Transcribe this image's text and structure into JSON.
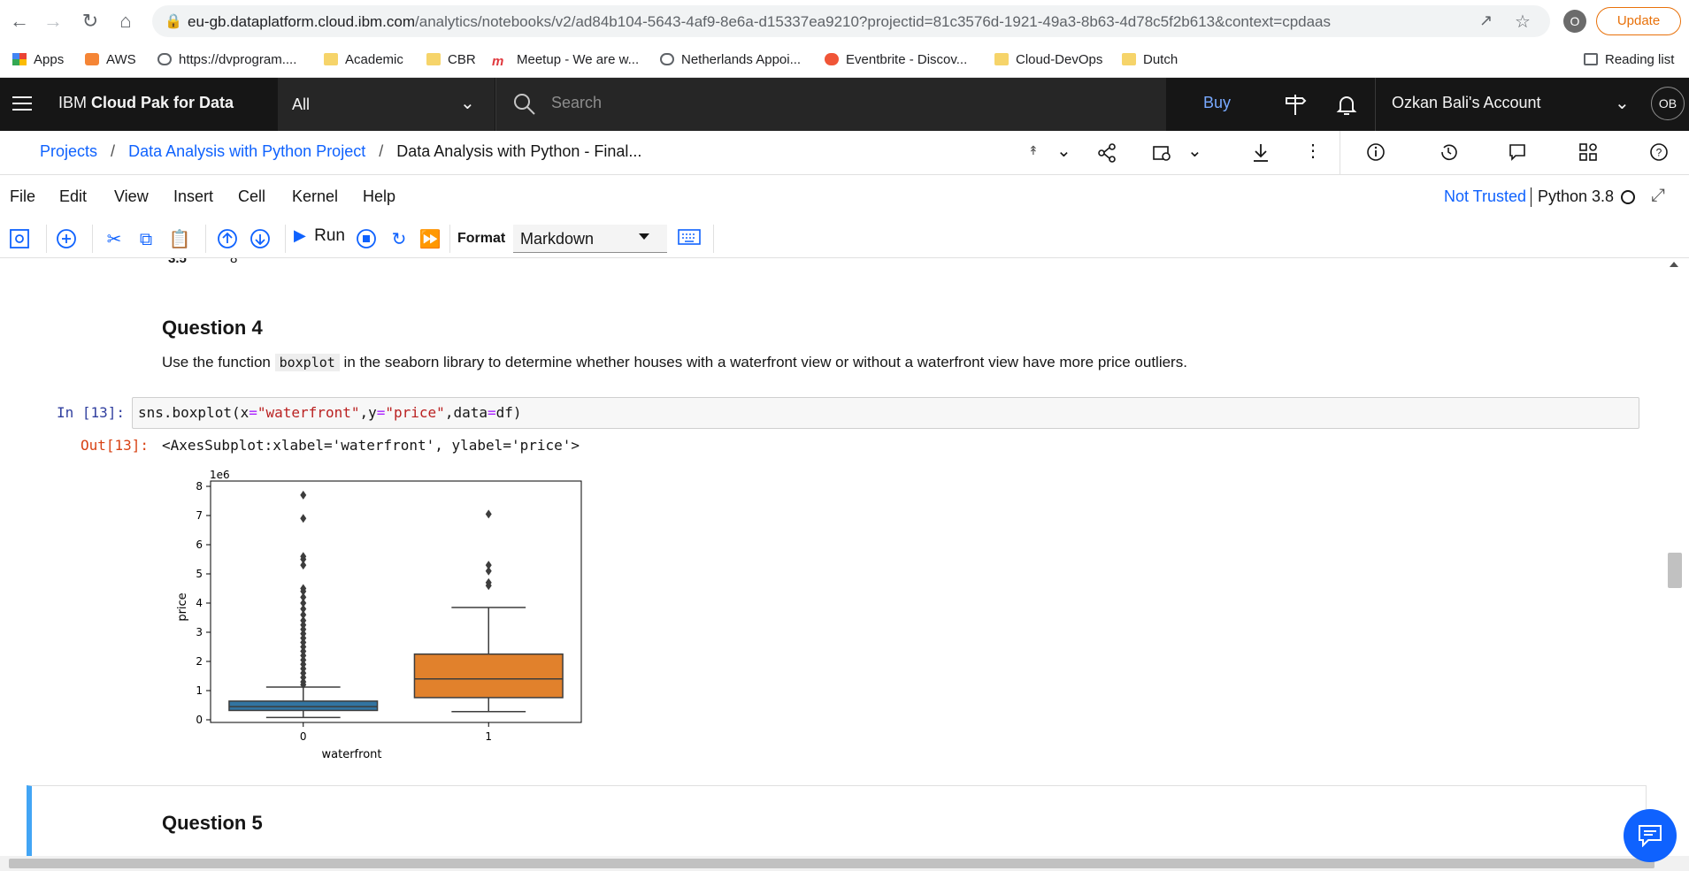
{
  "browser": {
    "url_host": "eu-gb.dataplatform.cloud.ibm.com",
    "url_path": "/analytics/notebooks/v2/ad84b104-5643-4af9-8e6a-d15337ea9210?projectid=81c3576d-1921-49a3-8b63-4d78c5f2b613&context=cpdaas",
    "profile_initial": "O",
    "update_label": "Update",
    "reading_list_label": "Reading list",
    "bookmarks": [
      {
        "label": "Apps",
        "icon": "apps-grid-icon"
      },
      {
        "label": "AWS",
        "icon": "aws-icon"
      },
      {
        "label": "https://dvprogram....",
        "icon": "globe-icon"
      },
      {
        "label": "Academic",
        "icon": "folder-icon"
      },
      {
        "label": "CBR",
        "icon": "folder-icon"
      },
      {
        "label": "Meetup - We are w...",
        "icon": "meetup-icon"
      },
      {
        "label": "Netherlands Appoi...",
        "icon": "globe-icon"
      },
      {
        "label": "Eventbrite - Discov...",
        "icon": "eventbrite-icon"
      },
      {
        "label": "Cloud-DevOps",
        "icon": "folder-icon"
      },
      {
        "label": "Dutch",
        "icon": "folder-icon"
      }
    ]
  },
  "header": {
    "brand_prefix": "IBM ",
    "brand_name": "Cloud Pak for Data",
    "scope_value": "All",
    "search_placeholder": "Search",
    "buy_label": "Buy",
    "account_name": "Ozkan Bali's Account",
    "avatar_initials": "OB"
  },
  "breadcrumb": {
    "items": [
      "Projects",
      "Data Analysis with Python Project",
      "Data Analysis with Python - Final..."
    ],
    "separator": "/"
  },
  "menu": {
    "items": [
      "File",
      "Edit",
      "View",
      "Insert",
      "Cell",
      "Kernel",
      "Help"
    ],
    "trust_label": "Not Trusted",
    "kernel_label": "Python 3.8"
  },
  "toolbar": {
    "run_label": "Run",
    "format_label": "Format",
    "format_value": "Markdown"
  },
  "notebook": {
    "prev_row": {
      "index": "3.5",
      "value": "8"
    },
    "q4_title": "Question 4",
    "q4_text_before": "Use the function",
    "q4_code_word": "boxplot",
    "q4_text_after": "in the seaborn library to determine whether houses with a waterfront view or without a waterfront view have more price outliers.",
    "in_prompt": "In [13]:",
    "code_parts": [
      "sns.boxplot(x",
      "=",
      "\"waterfront\"",
      ",y",
      "=",
      "\"price\"",
      ",data",
      "=",
      "df)"
    ],
    "out_prompt": "Out[13]:",
    "out_text": "<AxesSubplot:xlabel='waterfront', ylabel='price'>",
    "q5_title": "Question 5"
  },
  "chart_data": {
    "type": "box",
    "title": "",
    "xlabel": "waterfront",
    "ylabel": "price",
    "y_multiplier_label": "1e6",
    "ylim": [
      0,
      8
    ],
    "yticks": [
      "0",
      "1",
      "2",
      "3",
      "4",
      "5",
      "6",
      "7",
      "8"
    ],
    "categories": [
      "0",
      "1"
    ],
    "colors": [
      "#3274a1",
      "#e1812c"
    ],
    "boxes": [
      {
        "category": "0",
        "whisker_low": 0.08,
        "q1": 0.32,
        "median": 0.45,
        "q3": 0.64,
        "whisker_high": 1.12,
        "outliers": [
          1.2,
          1.3,
          1.45,
          1.6,
          1.75,
          1.9,
          2.05,
          2.2,
          2.35,
          2.5,
          2.65,
          2.8,
          2.95,
          3.1,
          3.25,
          3.4,
          3.6,
          3.8,
          4.0,
          4.2,
          4.4,
          4.5,
          5.3,
          5.5,
          5.6,
          6.9,
          7.7
        ]
      },
      {
        "category": "1",
        "whisker_low": 0.28,
        "q1": 0.76,
        "median": 1.4,
        "q3": 2.25,
        "whisker_high": 3.85,
        "outliers": [
          4.6,
          4.7,
          5.1,
          5.3,
          7.05
        ]
      }
    ]
  }
}
